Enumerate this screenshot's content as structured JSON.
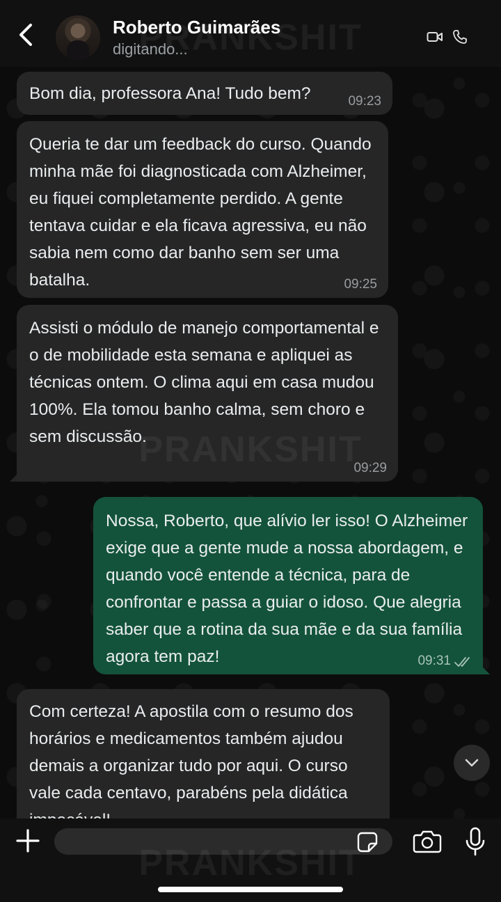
{
  "header": {
    "contact_name": "Roberto Guimarães",
    "status": "digitando..."
  },
  "watermark": "PRANKSHIT",
  "messages": [
    {
      "direction": "in",
      "text": "Bom dia, professora Ana! Tudo bem?",
      "time": "09:23"
    },
    {
      "direction": "in",
      "text": "Queria te dar um feedback do curso. Quando minha mãe foi diagnosticada com Alzheimer, eu fiquei completamente perdido. A gente tentava cuidar e ela ficava agressiva, eu não sabia nem como dar banho sem ser uma batalha.",
      "time": "09:25"
    },
    {
      "direction": "in",
      "text": "Assisti o módulo de manejo comportamental e o de mobilidade esta semana e apliquei as técnicas ontem. O clima aqui em casa mudou 100%. Ela tomou banho calma, sem choro e sem discussão.",
      "time": "09:29"
    },
    {
      "direction": "out",
      "text": "Nossa, Roberto, que alívio ler isso! O Alzheimer exige que a gente mude a nossa abordagem, e quando você entende a técnica, para de confrontar e passa a guiar o idoso. Que alegria saber que a rotina da sua mãe e da sua família agora tem paz!",
      "time": "09:31",
      "status": "read"
    },
    {
      "direction": "in",
      "text": "Com certeza! A apostila com o resumo dos horários e medicamentos também ajudou demais a organizar tudo por aqui. O curso vale cada centavo, parabéns pela didática impecável!",
      "time": ""
    }
  ],
  "composer": {
    "value": "",
    "placeholder": ""
  },
  "icons": {
    "back": "chevron-left-icon",
    "video": "video-camera-icon",
    "call": "phone-icon",
    "scroll_down": "chevron-down-icon",
    "plus": "plus-icon",
    "sticker": "sticker-icon",
    "camera": "camera-icon",
    "mic": "microphone-icon"
  },
  "colors": {
    "incoming_bubble": "#262626",
    "outgoing_bubble": "#14533b",
    "header_bg": "#111111"
  }
}
